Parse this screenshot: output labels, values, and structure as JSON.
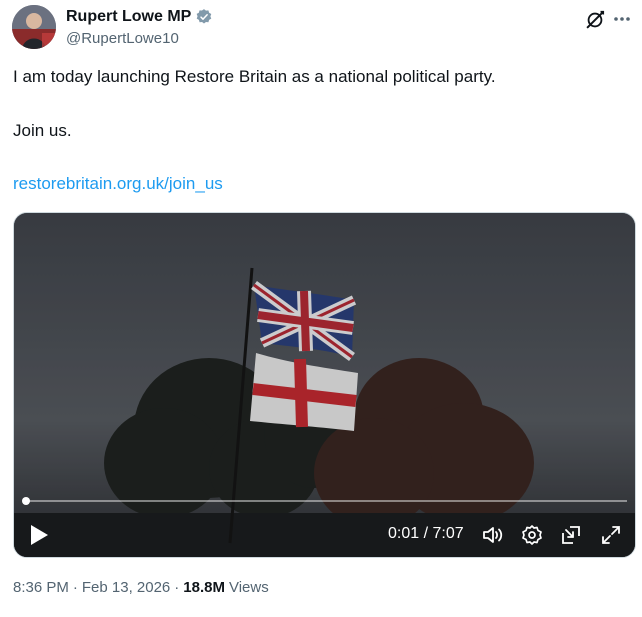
{
  "author": {
    "display_name": "Rupert Lowe MP",
    "handle": "@RupertLowe10",
    "verified": true
  },
  "icons": {
    "verified": "verified-badge-icon",
    "grok": "grok-icon",
    "more": "more-options-icon"
  },
  "tweet": {
    "line1": "I am today launching Restore Britain as a national political party.",
    "line2": "Join us.",
    "link": "restorebritain.org.uk/join_us"
  },
  "video": {
    "time": "0:01 / 7:07",
    "progress": 0.003,
    "controls": [
      "play-icon",
      "volume-icon",
      "settings-icon",
      "pip-icon",
      "fullscreen-icon"
    ]
  },
  "meta": {
    "time": "8:36 PM",
    "separator": "·",
    "date": "Feb 13, 2026",
    "views_count": "18.8M",
    "views_label": "Views"
  },
  "colors": {
    "accent": "#1d9bf0",
    "text": "#0f1419",
    "muted": "#536471"
  }
}
